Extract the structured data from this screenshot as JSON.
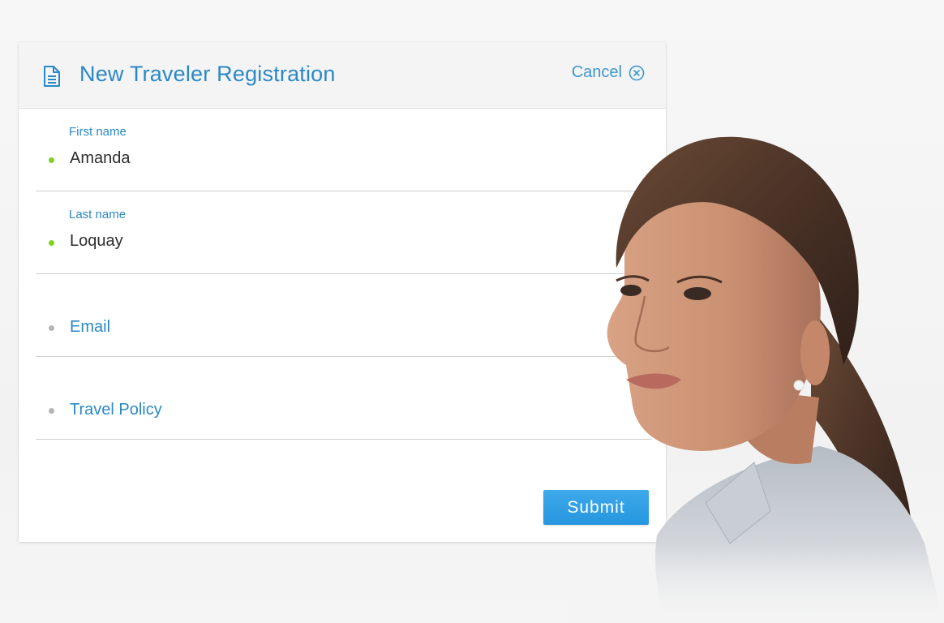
{
  "form": {
    "title": "New Traveler Registration",
    "title_icon": "document-icon",
    "cancel_label": "Cancel",
    "cancel_icon": "close-circle-icon",
    "submit_label": "Submit",
    "fields": [
      {
        "label": "First name",
        "value": "Amanda",
        "status": "valid"
      },
      {
        "label": "Last name",
        "value": "Loquay",
        "status": "valid"
      },
      {
        "placeholder": "Email",
        "status": "empty"
      },
      {
        "placeholder": "Travel Policy",
        "status": "empty"
      }
    ]
  },
  "colors": {
    "accent": "#2b88c6",
    "button": "#2a9be2",
    "valid_dot": "#7ed321",
    "empty_dot": "#b5b5b5",
    "header_bg": "#f4f4f5"
  }
}
